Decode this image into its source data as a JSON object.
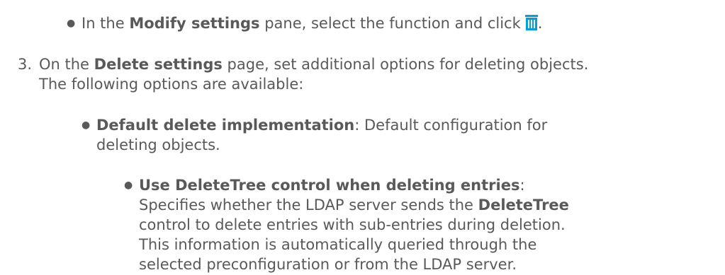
{
  "bullet_glyph": "●",
  "step1": {
    "prefix": "In the ",
    "pane_name": "Modify settings",
    "suffix": " pane, select the function and click",
    "icon": "trash-icon",
    "icon_color": "#00a0dc",
    "end": "."
  },
  "step3": {
    "number": "3.",
    "prefix": "On the ",
    "page_name": "Delete settings",
    "suffix": " page, set additional options for deleting objects.",
    "line2": "The following options are available:"
  },
  "option1": {
    "name": "Default delete implementation",
    "desc_line1": ": Default configuration for",
    "desc_line2": "deleting objects."
  },
  "option2": {
    "name": "Use DeleteTree control when deleting entries",
    "name_suffix": ":",
    "line2": "Specifies whether the LDAP server sends the ",
    "control_name": "DeleteTree",
    "line3": "control to delete entries with sub-entries during deletion.",
    "line4": "This information is automatically queried through the",
    "line5": "selected preconfiguration or from the LDAP server."
  }
}
